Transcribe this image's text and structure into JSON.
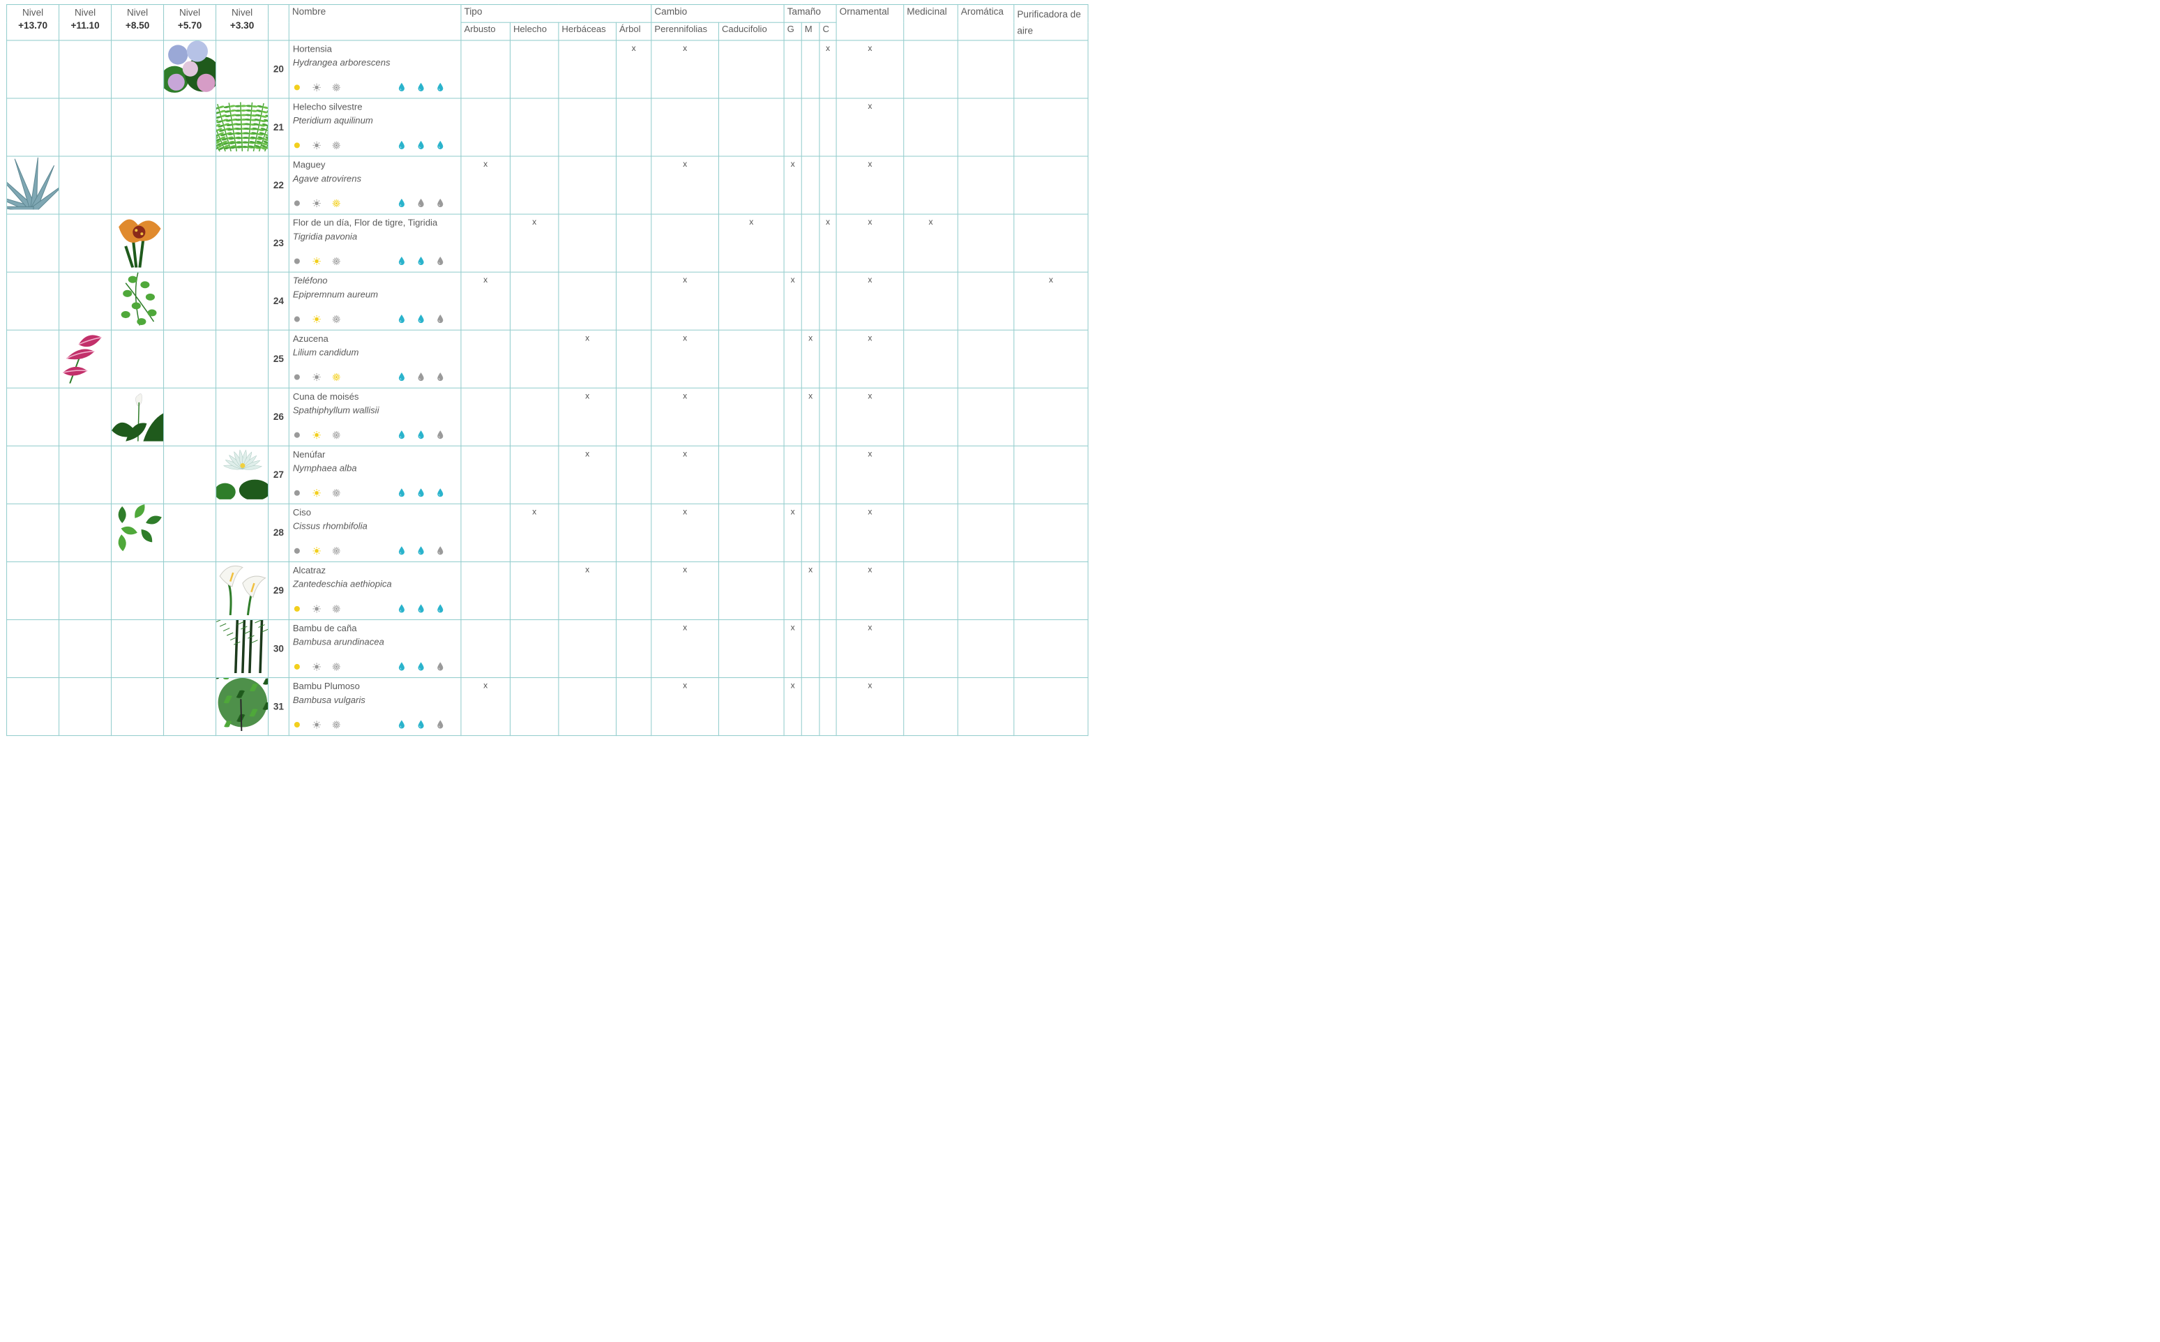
{
  "headers": {
    "levels": [
      {
        "label": "Nivel",
        "value": "+13.70"
      },
      {
        "label": "Nivel",
        "value": "+11.10"
      },
      {
        "label": "Nivel",
        "value": "+8.50"
      },
      {
        "label": "Nivel",
        "value": "+5.70"
      },
      {
        "label": "Nivel",
        "value": "+3.30"
      }
    ],
    "nombre": "Nombre",
    "tipo": "Tipo",
    "tipo_sub": [
      "Arbusto",
      "Helecho",
      "Herbáceas",
      "Árbol"
    ],
    "cambio": "Cambio",
    "cambio_sub": [
      "Perennifolias",
      "Caducifolio"
    ],
    "tamano": "Tamaño",
    "tamano_sub": [
      "G",
      "M",
      "C"
    ],
    "ornamental": "Ornamental",
    "medicinal": "Medicinal",
    "aromatica": "Aromática",
    "purificadora": "Purificadora de aire"
  },
  "colors": {
    "grid": "#8fcbcb",
    "sun_active": "#f2cf1d",
    "sun_inactive": "#9a9a9a",
    "drop_active": "#2ab3cc",
    "drop_inactive": "#9a9a9a"
  },
  "rows": [
    {
      "num": "20",
      "common": "Hortensia",
      "scientific": "Hydrangea arborescens",
      "sun": [
        1,
        0,
        0
      ],
      "water": [
        1,
        1,
        1
      ],
      "level": 3,
      "plant": "hydrangea",
      "marks": {
        "arbusto": "",
        "helecho": "",
        "herbaceas": "",
        "arbol": "x",
        "perennifolias": "x",
        "caducifolio": "",
        "g": "",
        "m": "",
        "c": "x",
        "ornamental": "x",
        "medicinal": "",
        "aromatica": "",
        "purificadora": ""
      }
    },
    {
      "num": "21",
      "common": "Helecho silvestre",
      "scientific": "Pteridium aquilinum",
      "sun": [
        1,
        0,
        0
      ],
      "water": [
        1,
        1,
        1
      ],
      "level": 4,
      "plant": "fern",
      "marks": {
        "arbusto": "",
        "helecho": "",
        "herbaceas": "",
        "arbol": "",
        "perennifolias": "",
        "caducifolio": "",
        "g": "",
        "m": "",
        "c": "",
        "ornamental": "x",
        "medicinal": "",
        "aromatica": "",
        "purificadora": ""
      }
    },
    {
      "num": "22",
      "common": "Maguey",
      "scientific": "Agave atrovirens",
      "sun": [
        0,
        0,
        1
      ],
      "water": [
        1,
        0,
        0
      ],
      "level": 0,
      "plant": "agave",
      "marks": {
        "arbusto": "x",
        "helecho": "",
        "herbaceas": "",
        "arbol": "",
        "perennifolias": "x",
        "caducifolio": "",
        "g": "x",
        "m": "",
        "c": "",
        "ornamental": "x",
        "medicinal": "",
        "aromatica": "",
        "purificadora": ""
      }
    },
    {
      "num": "23",
      "common": "Flor de un día, Flor de tigre, Tigridia",
      "scientific": "Tigridia pavonia",
      "sun": [
        0,
        1,
        0
      ],
      "water": [
        1,
        1,
        0
      ],
      "level": 2,
      "plant": "tigridia",
      "marks": {
        "arbusto": "",
        "helecho": "x",
        "herbaceas": "",
        "arbol": "",
        "perennifolias": "",
        "caducifolio": "x",
        "g": "",
        "m": "",
        "c": "x",
        "ornamental": "x",
        "medicinal": "x",
        "aromatica": "",
        "purificadora": ""
      }
    },
    {
      "num": "24",
      "common": "Teléfono",
      "scientific": "Epipremnum aureum",
      "sun": [
        0,
        1,
        0
      ],
      "water": [
        1,
        1,
        0
      ],
      "level": 2,
      "plant": "pothos",
      "italic_common": true,
      "marks": {
        "arbusto": "x",
        "helecho": "",
        "herbaceas": "",
        "arbol": "",
        "perennifolias": "x",
        "caducifolio": "",
        "g": "x",
        "m": "",
        "c": "",
        "ornamental": "x",
        "medicinal": "",
        "aromatica": "",
        "purificadora": "x"
      }
    },
    {
      "num": "25",
      "common": "Azucena",
      "scientific": "Lilium candidum",
      "sun": [
        0,
        0,
        1
      ],
      "water": [
        1,
        0,
        0
      ],
      "level": 1,
      "plant": "lily",
      "marks": {
        "arbusto": "",
        "helecho": "",
        "herbaceas": "x",
        "arbol": "",
        "perennifolias": "x",
        "caducifolio": "",
        "g": "",
        "m": "x",
        "c": "",
        "ornamental": "x",
        "medicinal": "",
        "aromatica": "",
        "purificadora": ""
      }
    },
    {
      "num": "26",
      "common": "Cuna de moisés",
      "scientific": "Spathiphyllum wallisii",
      "sun": [
        0,
        1,
        0
      ],
      "water": [
        1,
        1,
        0
      ],
      "level": 2,
      "plant": "peace-lily",
      "marks": {
        "arbusto": "",
        "helecho": "",
        "herbaceas": "x",
        "arbol": "",
        "perennifolias": "x",
        "caducifolio": "",
        "g": "",
        "m": "x",
        "c": "",
        "ornamental": "x",
        "medicinal": "",
        "aromatica": "",
        "purificadora": ""
      }
    },
    {
      "num": "27",
      "common": "Nenúfar",
      "scientific": "Nymphaea alba",
      "sun": [
        0,
        1,
        0
      ],
      "water": [
        1,
        1,
        1
      ],
      "level": 4,
      "plant": "water-lily",
      "marks": {
        "arbusto": "",
        "helecho": "",
        "herbaceas": "x",
        "arbol": "",
        "perennifolias": "x",
        "caducifolio": "",
        "g": "",
        "m": "",
        "c": "",
        "ornamental": "x",
        "medicinal": "",
        "aromatica": "",
        "purificadora": ""
      }
    },
    {
      "num": "28",
      "common": "Ciso",
      "scientific": "Cissus rhombifolia",
      "sun": [
        0,
        1,
        0
      ],
      "water": [
        1,
        1,
        0
      ],
      "level": 2,
      "plant": "cissus",
      "marks": {
        "arbusto": "",
        "helecho": "x",
        "herbaceas": "",
        "arbol": "",
        "perennifolias": "x",
        "caducifolio": "",
        "g": "x",
        "m": "",
        "c": "",
        "ornamental": "x",
        "medicinal": "",
        "aromatica": "",
        "purificadora": ""
      }
    },
    {
      "num": "29",
      "common": "Alcatraz",
      "scientific": "Zantedeschia aethiopica",
      "sun": [
        1,
        0,
        0
      ],
      "water": [
        1,
        1,
        1
      ],
      "level": 4,
      "plant": "calla",
      "marks": {
        "arbusto": "",
        "helecho": "",
        "herbaceas": "x",
        "arbol": "",
        "perennifolias": "x",
        "caducifolio": "",
        "g": "",
        "m": "x",
        "c": "",
        "ornamental": "x",
        "medicinal": "",
        "aromatica": "",
        "purificadora": ""
      }
    },
    {
      "num": "30",
      "common": "Bambu de caña",
      "scientific": "Bambusa arundinacea",
      "sun": [
        1,
        0,
        0
      ],
      "water": [
        1,
        1,
        0
      ],
      "level": 4,
      "plant": "bamboo",
      "marks": {
        "arbusto": "",
        "helecho": "",
        "herbaceas": "",
        "arbol": "",
        "perennifolias": "x",
        "caducifolio": "",
        "g": "x",
        "m": "",
        "c": "",
        "ornamental": "x",
        "medicinal": "",
        "aromatica": "",
        "purificadora": ""
      }
    },
    {
      "num": "31",
      "common": "Bambu Plumoso",
      "scientific": "Bambusa vulgaris",
      "sun": [
        1,
        0,
        0
      ],
      "water": [
        1,
        1,
        0
      ],
      "level": 4,
      "plant": "bamboo-plume",
      "marks": {
        "arbusto": "x",
        "helecho": "",
        "herbaceas": "",
        "arbol": "",
        "perennifolias": "x",
        "caducifolio": "",
        "g": "x",
        "m": "",
        "c": "",
        "ornamental": "x",
        "medicinal": "",
        "aromatica": "",
        "purificadora": ""
      }
    }
  ]
}
